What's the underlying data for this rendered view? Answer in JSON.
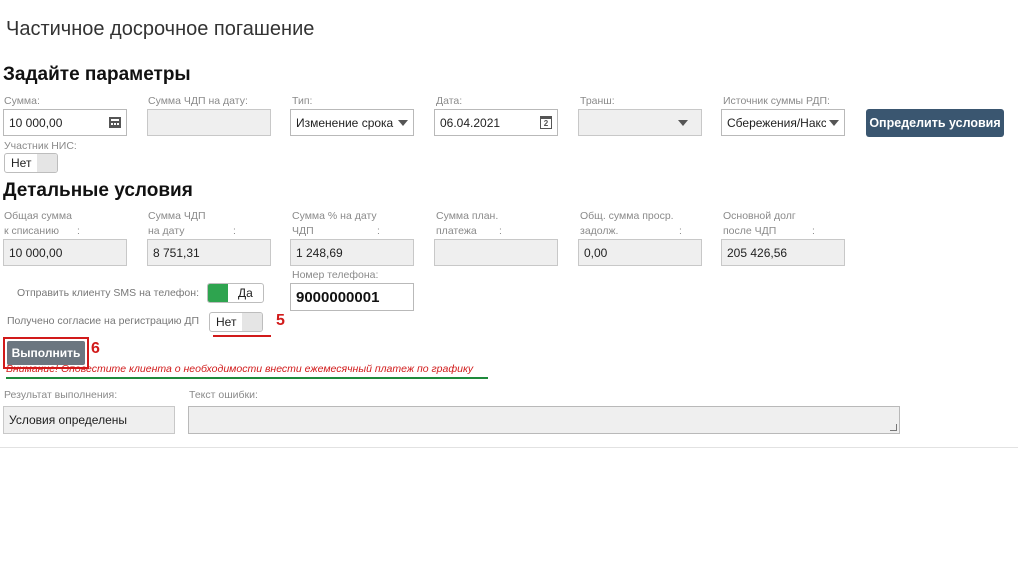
{
  "header": {
    "title": "Частичное досрочное погашение"
  },
  "params": {
    "section_title": "Задайте параметры",
    "amount": {
      "label": "Сумма:",
      "value": "10 000,00",
      "icon": "calculator-icon"
    },
    "chdp_on_date": {
      "label": "Сумма ЧДП на дату:",
      "value": ""
    },
    "type": {
      "label": "Тип:",
      "value": "Изменение срока"
    },
    "date": {
      "label": "Дата:",
      "value": "06.04.2021",
      "icon": "calendar-icon",
      "icon_text": "2"
    },
    "tranche": {
      "label": "Транш:",
      "value": ""
    },
    "source": {
      "label": "Источник суммы РДП:",
      "value": "Сбережения/Накс"
    },
    "determine_button": "Определить условия",
    "nis_participant": {
      "label": "Участник НИС:",
      "value": "Нет"
    }
  },
  "details": {
    "section_title": "Детальные условия",
    "fields": [
      {
        "label1": "Общая сумма",
        "label2": "к списанию",
        "value": "10 000,00"
      },
      {
        "label1": "Сумма ЧДП",
        "label2": "на дату",
        "value": "8 751,31"
      },
      {
        "label1": "Сумма % на дату",
        "label2": "ЧДП",
        "value": "1 248,69"
      },
      {
        "label1": "Сумма план.",
        "label2": "платежа",
        "value": ""
      },
      {
        "label1": "Общ. сумма проср.",
        "label2": "задолж.",
        "value": "0,00"
      },
      {
        "label1": "Основной долг",
        "label2": "после ЧДП",
        "value": "205 426,56"
      }
    ],
    "colon": ":",
    "sms": {
      "label": "Отправить клиенту SMS на телефон:",
      "value": "Да"
    },
    "phone": {
      "label": "Номер телефона:",
      "value": "9000000001"
    },
    "consent": {
      "label": "Получено согласие на регистрацию ДП",
      "value": "Нет"
    },
    "marker_5": "5"
  },
  "actions": {
    "execute_button": "Выполнить",
    "marker_6": "6",
    "warning": "Внимание! Оповестите клиента о необходимости внести ежемесячный платеж по графику"
  },
  "result": {
    "label": "Результат выполнения:",
    "value": "Условия определены",
    "error_label": "Текст ошибки:",
    "error_value": ""
  },
  "colors": {
    "accent": "#3a5670",
    "toggle_on": "#2ea44f",
    "annotation_red": "#d11a1a",
    "annotation_green": "#1e8a3c"
  }
}
